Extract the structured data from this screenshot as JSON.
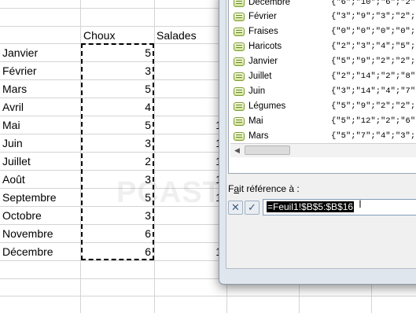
{
  "sheet": {
    "headers": [
      "Choux",
      "Salades"
    ],
    "rows": [
      {
        "month": "Janvier",
        "value": "5"
      },
      {
        "month": "Février",
        "value": "3"
      },
      {
        "month": "Mars",
        "value": "5"
      },
      {
        "month": "Avril",
        "value": "4"
      },
      {
        "month": "Mai",
        "value": "5"
      },
      {
        "month": "Juin",
        "value": "3"
      },
      {
        "month": "Juillet",
        "value": "2"
      },
      {
        "month": "Août",
        "value": "3"
      },
      {
        "month": "Septembre",
        "value": "5"
      },
      {
        "month": "Octobre",
        "value": "3"
      },
      {
        "month": "Novembre",
        "value": "6"
      },
      {
        "month": "Décembre",
        "value": "6"
      }
    ],
    "cut_digits": [
      "1",
      "1",
      "1",
      "1",
      "1",
      "1"
    ],
    "cut_digit_last": "1"
  },
  "watermark": "PCASTUCES",
  "dialog": {
    "names": [
      {
        "label": "Décembre",
        "value": "{\"6\";\"10\";\"6\";\"2\";\""
      },
      {
        "label": "Février",
        "value": "{\"3\";\"9\";\"3\";\"2\";\"1"
      },
      {
        "label": "Fraises",
        "value": "{\"0\";\"0\";\"0\";\"0\";\"2"
      },
      {
        "label": "Haricots",
        "value": "{\"2\";\"3\";\"4\";\"5\";\"2"
      },
      {
        "label": "Janvier",
        "value": "{\"5\";\"9\";\"2\";\"2\";\"9"
      },
      {
        "label": "Juillet",
        "value": "{\"2\";\"14\";\"2\";\"8\";\""
      },
      {
        "label": "Juin",
        "value": "{\"3\";\"14\";\"4\";\"7\";\""
      },
      {
        "label": "Légumes",
        "value": "{\"5\";\"9\";\"2\";\"2\";\"9"
      },
      {
        "label": "Mai",
        "value": "{\"5\";\"12\";\"2\";\"6\";\""
      },
      {
        "label": "Mars",
        "value": "{\"5\";\"7\";\"4\";\"3\";\"9"
      }
    ],
    "ref_label_accel": "a",
    "ref_label_pre": "F",
    "ref_label_post": "it référence à :",
    "ref_value": "=Feuil1!$B$5:$B$16",
    "scroll_left_glyph": "◀",
    "cancel_glyph": "✕",
    "ok_glyph": "✓",
    "ibeam_glyph": "I"
  }
}
